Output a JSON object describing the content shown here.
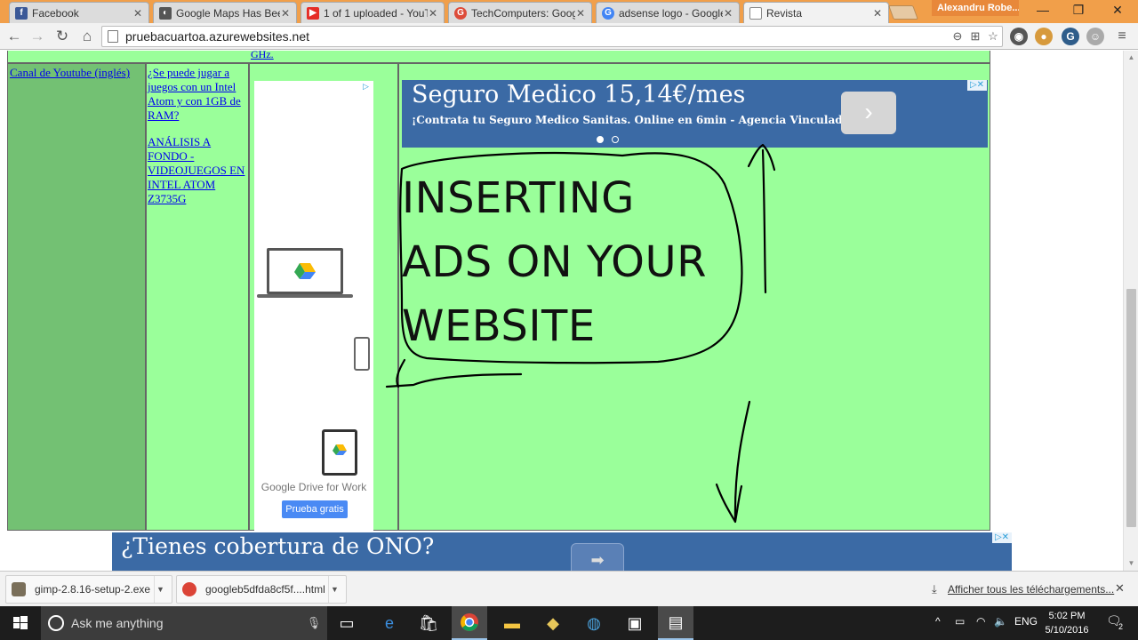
{
  "browser": {
    "tabs": [
      {
        "label": "Facebook",
        "favicon_color": "#3b5998",
        "favicon_glyph": "f"
      },
      {
        "label": "Google Maps Has Been",
        "favicon_color": "#555555",
        "favicon_glyph": "◐"
      },
      {
        "label": "1 of 1 uploaded - YouT",
        "favicon_color": "#e52d27",
        "favicon_glyph": "▶"
      },
      {
        "label": "TechComputers: Googl",
        "favicon_color": "#dd4b39",
        "favicon_glyph": "G"
      },
      {
        "label": "adsense logo - Google",
        "favicon_color": "#4285f4",
        "favicon_glyph": "G"
      },
      {
        "label": "Revista",
        "favicon_color": "#ffffff",
        "favicon_glyph": ""
      }
    ],
    "active_tab_index": 5,
    "profile_name": "Alexandru Robe...",
    "url": "pruebacuartoa.azurewebsites.net",
    "accent_color": "#f19f4a"
  },
  "page": {
    "top_link_fragment": "GHz.",
    "col1_link": "Canal de Youtube (inglés)",
    "col2_link1": "¿Se puede jugar a juegos con un Intel Atom y con 1GB de RAM?",
    "col2_link2": "ANÁLISIS A FONDO - VIDEOJUEGOS EN INTEL ATOM Z3735G",
    "drive_ad": {
      "caption": "Google Drive for Work",
      "cta": "Prueba gratis"
    },
    "seguro_ad": {
      "title": "Seguro Medico 15,14€/mes",
      "subtitle": "¡Contrata tu Seguro Medico Sanitas. Online en 6min - Agencia Vinculada®",
      "arrow": "›"
    },
    "drawing_text": [
      "INSERTING",
      "ADS ON YOUR",
      "WEBSITE"
    ],
    "ono_ad": {
      "title": "¿Tienes cobertura de ONO?",
      "arrow": "➡"
    },
    "ad_color": "#3b6aa5",
    "cell_green": "#9aff9a",
    "cell_dark_green": "#73c173"
  },
  "downloads": {
    "items": [
      {
        "name": "gimp-2.8.16-setup-2.exe"
      },
      {
        "name": "googleb5dfda8cf5f....html"
      }
    ],
    "show_all": "Afficher tous les téléchargements..."
  },
  "taskbar": {
    "search_placeholder": "Ask me anything",
    "language": "ENG",
    "time": "5:02 PM",
    "date": "5/10/2016",
    "notification_count": "2"
  }
}
